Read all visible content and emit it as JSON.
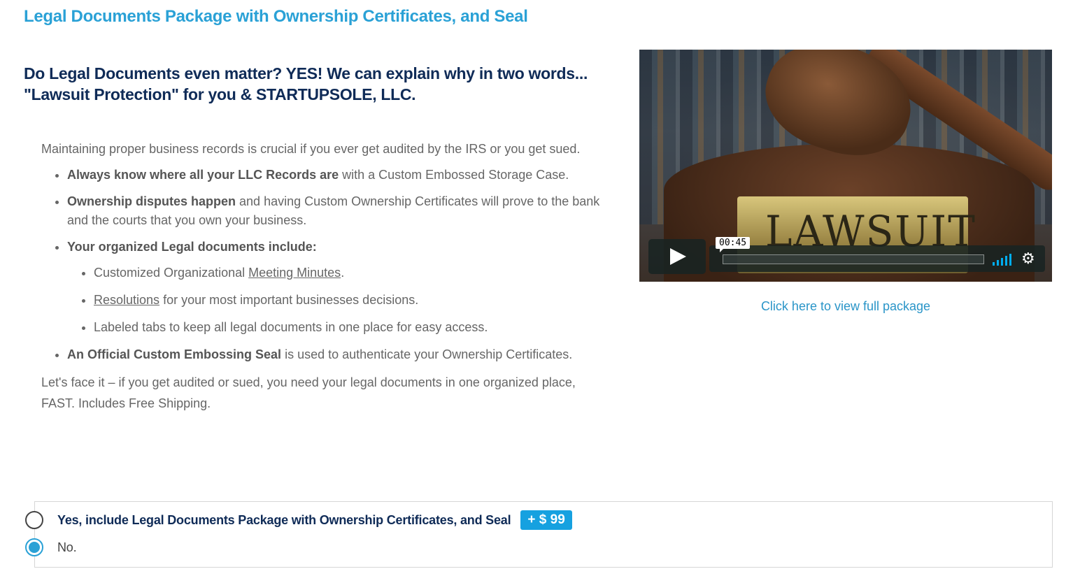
{
  "header": {
    "title": "Legal Documents Package with Ownership Certificates, and Seal"
  },
  "hero": {
    "headline_line1": "Do Legal Documents even matter? YES! We can explain why in two words...",
    "headline_line2": "\"Lawsuit Protection\" for you & STARTUPSOLE, LLC."
  },
  "content": {
    "intro": "Maintaining proper business records is crucial if you ever get audited by the IRS or you get sued.",
    "bullets": [
      {
        "bold": "Always know where all your LLC Records are",
        "text": " with a Custom Embossed Storage Case."
      },
      {
        "bold": "Ownership disputes happen",
        "text": " and having Custom Ownership Certificates will prove to the bank and the courts that you own your business."
      },
      {
        "bold": "Your organized Legal documents include:",
        "text": ""
      },
      {
        "bold": "An Official Custom Embossing Seal",
        "text": " is used to authenticate your Ownership Certificates."
      }
    ],
    "subitems": {
      "minutes_prefix": "Customized Organizational ",
      "minutes_link": "Meeting Minutes",
      "minutes_suffix": ".",
      "resolutions_link": "Resolutions",
      "resolutions_suffix": " for your most important businesses decisions.",
      "tabs_text": "Labeled tabs to keep all legal documents in one place for easy access."
    },
    "closing": "Let's face it – if you get audited or sued, you need your legal documents in one organized place, FAST. Includes Free Shipping."
  },
  "video": {
    "plate_text": "LAWSUIT",
    "timecode": "00:45",
    "progress": 0,
    "icons": {
      "play": "play-icon",
      "volume": "volume-icon",
      "settings": "gear-icon"
    }
  },
  "view_link": "Click here to view full package",
  "options": {
    "yes_label": "Yes, include Legal Documents Package with Ownership Certificates, and Seal",
    "price": "+ $ 99",
    "no_label": "No.",
    "selected": "no"
  },
  "colors": {
    "accent": "#2aa1d6",
    "navy": "#0f2b57",
    "price_bg": "#16a1e0",
    "text": "#666666"
  }
}
